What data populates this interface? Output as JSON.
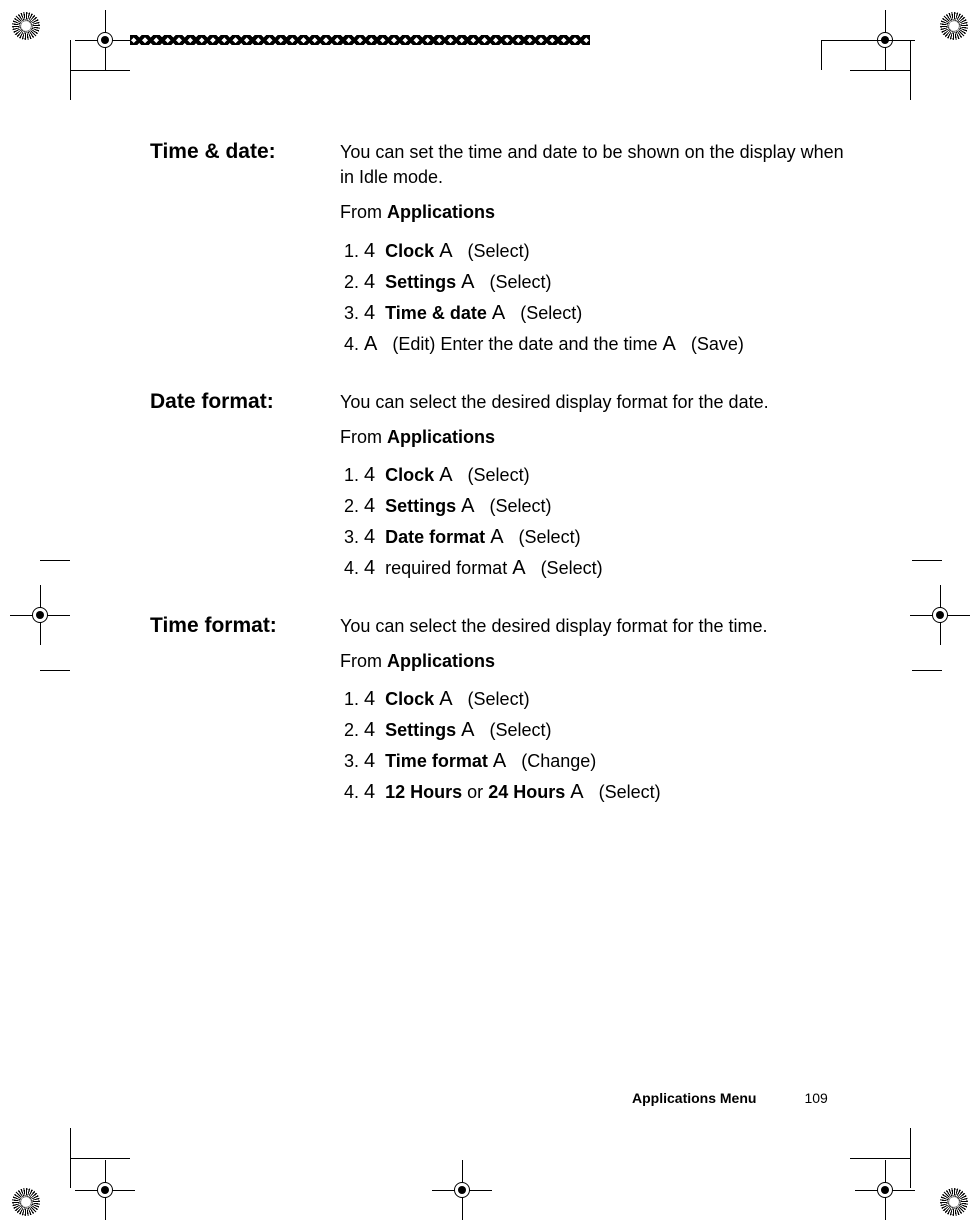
{
  "footer": {
    "title": "Applications Menu",
    "page": "109"
  },
  "sections": [
    {
      "heading": "Time & date:",
      "intro": "You can set the time and date to be shown on the display when in Idle mode.",
      "from_prefix": "From ",
      "from_bold": "Applications",
      "steps": [
        {
          "pre": "4",
          "bold": "Clock",
          "sym": "A",
          "post": " (Select)"
        },
        {
          "pre": "4",
          "bold": "Settings",
          "sym": "A",
          "post": " (Select)"
        },
        {
          "pre": "4",
          "bold": "Time & date",
          "sym": "A",
          "post": " (Select)"
        },
        {
          "pre": "",
          "bold": "",
          "sym": "A",
          "post": " (Edit) Enter the date and the time ",
          "sym2": "A",
          "post2": " (Save)"
        }
      ]
    },
    {
      "heading": "Date format:",
      "intro": "You can select the desired display format for the date.",
      "from_prefix": "From ",
      "from_bold": "Applications",
      "steps": [
        {
          "pre": "4",
          "bold": "Clock",
          "sym": "A",
          "post": " (Select)"
        },
        {
          "pre": "4",
          "bold": "Settings",
          "sym": "A",
          "post": " (Select)"
        },
        {
          "pre": "4",
          "bold": "Date format",
          "sym": "A",
          "post": " (Select)"
        },
        {
          "pre": "4",
          "bold": "",
          "plain": "required format ",
          "sym": "A",
          "post": " (Select)"
        }
      ]
    },
    {
      "heading": "Time format:",
      "intro": "You can select the desired display format for the time.",
      "from_prefix": "From ",
      "from_bold": "Applications",
      "steps": [
        {
          "pre": "4",
          "bold": "Clock",
          "sym": "A",
          "post": " (Select)"
        },
        {
          "pre": "4",
          "bold": "Settings",
          "sym": "A",
          "post": " (Select)"
        },
        {
          "pre": "4",
          "bold": "Time format",
          "sym": "A",
          "post": " (Change)"
        },
        {
          "pre": "4",
          "bold": "12 Hours",
          "plain": " or ",
          "bold2": "24 Hours",
          "sym": "A",
          "post": " (Select)"
        }
      ]
    }
  ]
}
